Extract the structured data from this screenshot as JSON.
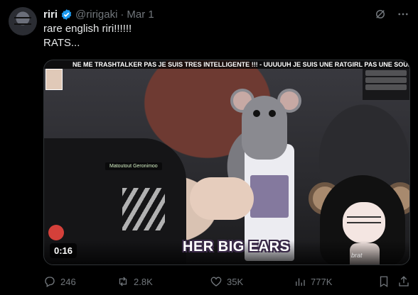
{
  "tweet": {
    "author_name": "riri",
    "verified_icon": "verified-badge-icon",
    "handle": "@ririgaki",
    "separator": "·",
    "date": "Mar 1",
    "text_line1": "rare english riri!!!!!!",
    "text_line2": "RATS...",
    "header_icons": [
      "grok-icon",
      "more-icon"
    ]
  },
  "media": {
    "duration": "0:16",
    "caption": "HER BIG EARS",
    "ticker": "NE ME TRASHTALKER PAS JE SUIS TRES INTELLIGENTE !!! - UUUUUH JE SUIS UNE RATGIRL PAS UNE SOURIS - REC",
    "follow_banner": "Matoutout Geronimoo",
    "signature": "brat"
  },
  "actions": {
    "replies": "246",
    "reposts": "2.8K",
    "likes": "35K",
    "views": "777K"
  },
  "colors": {
    "background": "#000000",
    "text": "#e7e9ea",
    "muted": "#71767b",
    "verified": "#1d9bf0"
  }
}
